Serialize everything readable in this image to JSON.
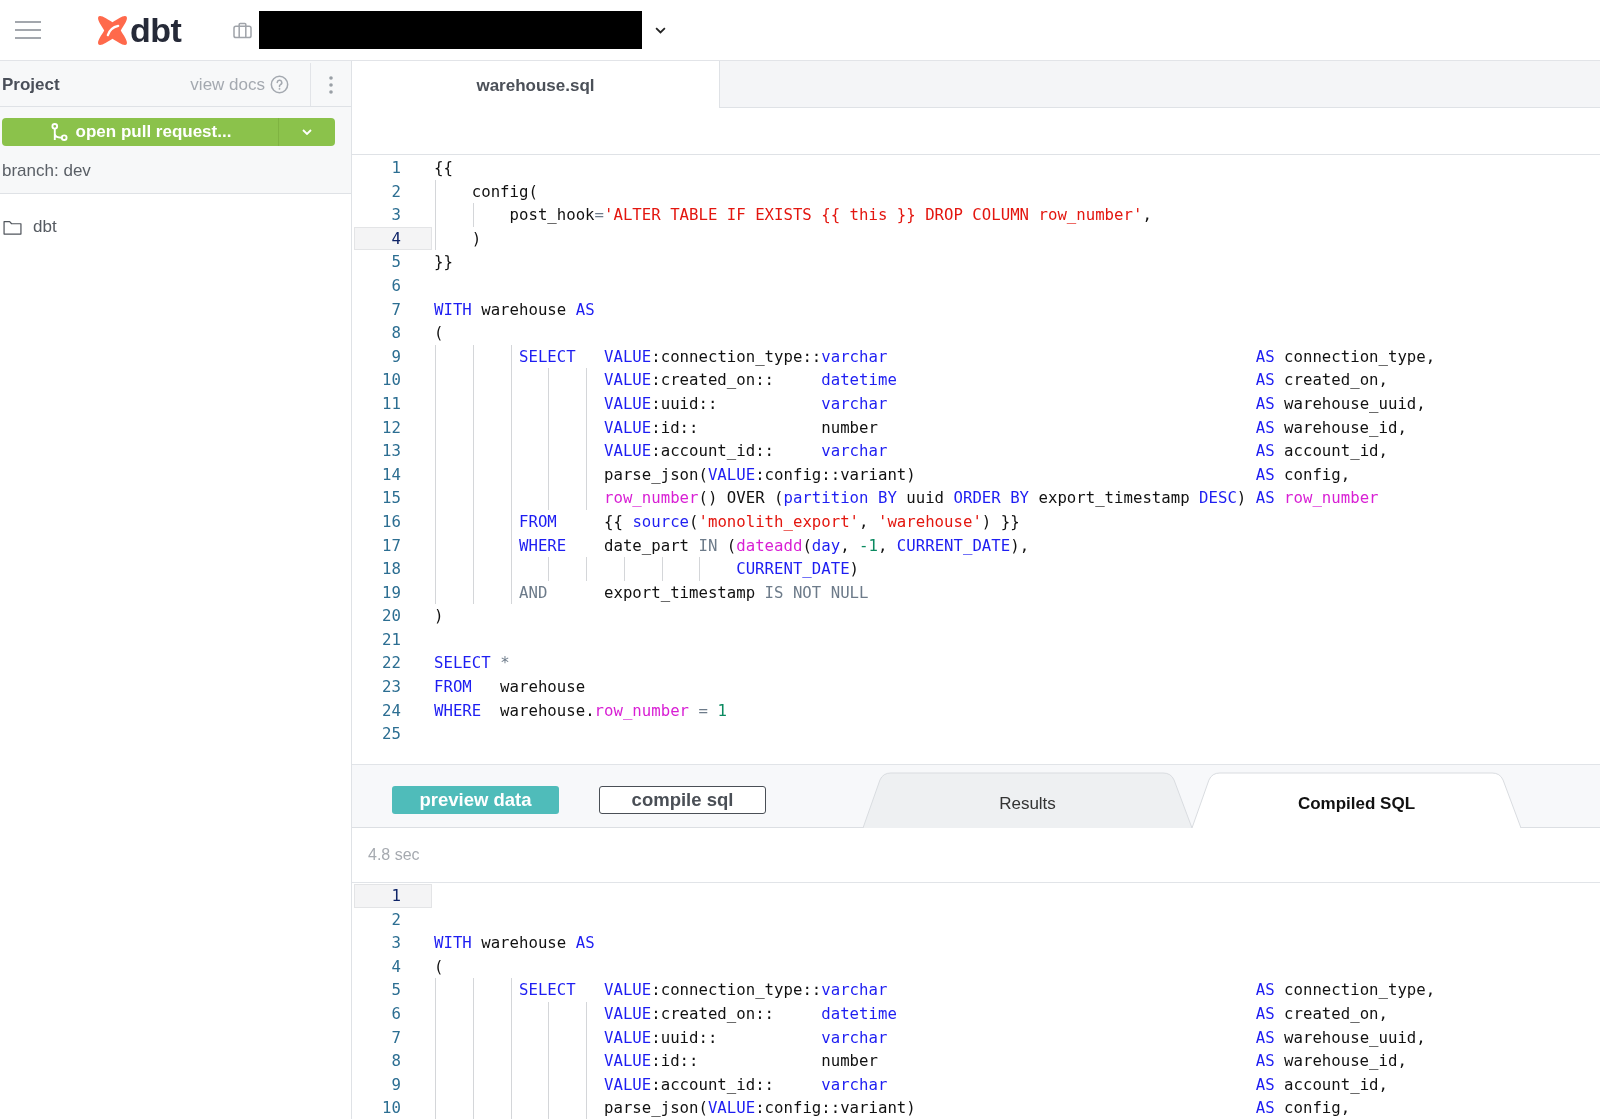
{
  "top_bar": {
    "logo": "dbt"
  },
  "sidebar": {
    "title": "Project",
    "docs_link": "view docs",
    "pull_request_button": "open pull request...",
    "branch": "branch: dev",
    "files": [
      {
        "name": "dbt",
        "kind": "folder"
      }
    ]
  },
  "file_tabs": [
    {
      "label": "warehouse.sql",
      "selected": true
    }
  ],
  "editor": {
    "lines": [
      {
        "number": "1",
        "active": false,
        "tokens": [
          {
            "kind": "plain",
            "text": "{{"
          }
        ]
      },
      {
        "number": "2",
        "active": false,
        "tokens": [
          {
            "kind": "plain",
            "text": "    config("
          }
        ]
      },
      {
        "number": "3",
        "active": false,
        "tokens": [
          {
            "kind": "plain",
            "text": "        post_hook"
          },
          {
            "kind": "operator",
            "text": "="
          },
          {
            "kind": "string",
            "text": "'ALTER TABLE IF EXISTS {{ this }} DROP COLUMN row_number'"
          },
          {
            "kind": "plain",
            "text": ","
          }
        ]
      },
      {
        "number": "4",
        "active": true,
        "tokens": [
          {
            "kind": "plain",
            "text": "    )"
          }
        ]
      },
      {
        "number": "5",
        "active": false,
        "tokens": [
          {
            "kind": "plain",
            "text": "}}"
          }
        ]
      },
      {
        "number": "6",
        "active": false
      },
      {
        "number": "7",
        "active": false,
        "tokens": [
          {
            "kind": "keyword",
            "text": "WITH"
          },
          {
            "kind": "plain",
            "text": " warehouse "
          },
          {
            "kind": "keyword",
            "text": "AS"
          }
        ]
      },
      {
        "number": "8",
        "active": false,
        "tokens": [
          {
            "kind": "plain",
            "text": "("
          }
        ]
      },
      {
        "number": "9",
        "active": false,
        "tokens": [
          {
            "kind": "keyword",
            "text": "         SELECT   "
          },
          {
            "kind": "keyword",
            "text": "VALUE"
          },
          {
            "kind": "plain",
            "text": ":connection_type::"
          },
          {
            "kind": "keyword",
            "text": "varchar                                       "
          },
          {
            "kind": "keyword",
            "text": "AS"
          },
          {
            "kind": "plain",
            "text": " connection_type,"
          }
        ]
      },
      {
        "number": "10",
        "active": false,
        "tokens": [
          {
            "kind": "keyword",
            "text": "                  VALUE"
          },
          {
            "kind": "plain",
            "text": ":created_on::     "
          },
          {
            "kind": "keyword",
            "text": "datetime                                      "
          },
          {
            "kind": "keyword",
            "text": "AS"
          },
          {
            "kind": "plain",
            "text": " created_on,"
          }
        ]
      },
      {
        "number": "11",
        "active": false,
        "tokens": [
          {
            "kind": "keyword",
            "text": "                  VALUE"
          },
          {
            "kind": "plain",
            "text": ":uuid::           "
          },
          {
            "kind": "keyword",
            "text": "varchar                                       "
          },
          {
            "kind": "keyword",
            "text": "AS"
          },
          {
            "kind": "plain",
            "text": " warehouse_uuid,"
          }
        ]
      },
      {
        "number": "12",
        "active": false,
        "tokens": [
          {
            "kind": "keyword",
            "text": "                  VALUE"
          },
          {
            "kind": "plain",
            "text": ":id::             number                                        "
          },
          {
            "kind": "keyword",
            "text": "AS"
          },
          {
            "kind": "plain",
            "text": " warehouse_id,"
          }
        ]
      },
      {
        "number": "13",
        "active": false,
        "tokens": [
          {
            "kind": "keyword",
            "text": "                  VALUE"
          },
          {
            "kind": "plain",
            "text": ":account_id::     "
          },
          {
            "kind": "keyword",
            "text": "varchar                                       "
          },
          {
            "kind": "keyword",
            "text": "AS"
          },
          {
            "kind": "plain",
            "text": " account_id,"
          }
        ]
      },
      {
        "number": "14",
        "active": false,
        "tokens": [
          {
            "kind": "plain",
            "text": "                  parse_json("
          },
          {
            "kind": "keyword",
            "text": "VALUE"
          },
          {
            "kind": "plain",
            "text": ":config::variant)                                    "
          },
          {
            "kind": "keyword",
            "text": "AS"
          },
          {
            "kind": "plain",
            "text": " config,"
          }
        ]
      },
      {
        "number": "15",
        "active": false,
        "tokens": [
          {
            "kind": "function",
            "text": "                  row_number"
          },
          {
            "kind": "plain",
            "text": "() OVER ("
          },
          {
            "kind": "keyword",
            "text": "partition BY"
          },
          {
            "kind": "plain",
            "text": " uuid "
          },
          {
            "kind": "keyword",
            "text": "ORDER BY"
          },
          {
            "kind": "plain",
            "text": " export_timestamp "
          },
          {
            "kind": "keyword",
            "text": "DESC"
          },
          {
            "kind": "plain",
            "text": ") "
          },
          {
            "kind": "keyword",
            "text": "AS "
          },
          {
            "kind": "function",
            "text": "row_number"
          }
        ]
      },
      {
        "number": "16",
        "active": false,
        "tokens": [
          {
            "kind": "keyword",
            "text": "         FROM     "
          },
          {
            "kind": "plain",
            "text": "{{ "
          },
          {
            "kind": "keyword",
            "text": "source"
          },
          {
            "kind": "plain",
            "text": "("
          },
          {
            "kind": "string",
            "text": "'monolith_export'"
          },
          {
            "kind": "plain",
            "text": ", "
          },
          {
            "kind": "string",
            "text": "'warehouse'"
          },
          {
            "kind": "plain",
            "text": ") }}"
          }
        ]
      },
      {
        "number": "17",
        "active": false,
        "tokens": [
          {
            "kind": "keyword",
            "text": "         WHERE    "
          },
          {
            "kind": "plain",
            "text": "date_part "
          },
          {
            "kind": "operator",
            "text": "IN"
          },
          {
            "kind": "plain",
            "text": " ("
          },
          {
            "kind": "function",
            "text": "dateadd"
          },
          {
            "kind": "plain",
            "text": "("
          },
          {
            "kind": "keyword",
            "text": "day"
          },
          {
            "kind": "plain",
            "text": ", "
          },
          {
            "kind": "number",
            "text": "-1"
          },
          {
            "kind": "plain",
            "text": ", "
          },
          {
            "kind": "keyword",
            "text": "CURRENT_DATE"
          },
          {
            "kind": "plain",
            "text": "),"
          }
        ]
      },
      {
        "number": "18",
        "active": false,
        "tokens": [
          {
            "kind": "keyword",
            "text": "                                CURRENT_DATE"
          },
          {
            "kind": "plain",
            "text": ")"
          }
        ]
      },
      {
        "number": "19",
        "active": false,
        "tokens": [
          {
            "kind": "operator",
            "text": "         AND      "
          },
          {
            "kind": "plain",
            "text": "export_timestamp "
          },
          {
            "kind": "operator",
            "text": "IS NOT NULL"
          }
        ]
      },
      {
        "number": "20",
        "active": false,
        "tokens": [
          {
            "kind": "plain",
            "text": ")"
          }
        ]
      },
      {
        "number": "21",
        "active": false
      },
      {
        "number": "22",
        "active": false,
        "tokens": [
          {
            "kind": "keyword",
            "text": "SELECT "
          },
          {
            "kind": "operator",
            "text": "*"
          }
        ]
      },
      {
        "number": "23",
        "active": false,
        "tokens": [
          {
            "kind": "keyword",
            "text": "FROM"
          },
          {
            "kind": "plain",
            "text": "   warehouse"
          }
        ]
      },
      {
        "number": "24",
        "active": false,
        "tokens": [
          {
            "kind": "keyword",
            "text": "WHERE"
          },
          {
            "kind": "plain",
            "text": "  warehouse."
          },
          {
            "kind": "function",
            "text": "row_number"
          },
          {
            "kind": "operator",
            "text": " = "
          },
          {
            "kind": "number",
            "text": "1"
          }
        ]
      },
      {
        "number": "25",
        "active": false
      }
    ]
  },
  "toolbar": {
    "buttons": [
      {
        "label": "preview data",
        "kind": "primary"
      },
      {
        "label": "compile sql",
        "kind": "outline"
      }
    ],
    "tabs": [
      {
        "label": "Results",
        "selected": false
      },
      {
        "label": "Compiled SQL",
        "selected": true
      }
    ]
  },
  "run_status": "4.8 sec",
  "compiled_sql": {
    "lines": [
      {
        "number": "1",
        "active": true
      },
      {
        "number": "2",
        "active": false
      },
      {
        "number": "3",
        "active": false,
        "tokens": [
          {
            "kind": "keyword",
            "text": "WITH"
          },
          {
            "kind": "plain",
            "text": " warehouse "
          },
          {
            "kind": "keyword",
            "text": "AS"
          }
        ]
      },
      {
        "number": "4",
        "active": false,
        "tokens": [
          {
            "kind": "plain",
            "text": "("
          }
        ]
      },
      {
        "number": "5",
        "active": false,
        "tokens": [
          {
            "kind": "keyword",
            "text": "         SELECT   "
          },
          {
            "kind": "keyword",
            "text": "VALUE"
          },
          {
            "kind": "plain",
            "text": ":connection_type::"
          },
          {
            "kind": "keyword",
            "text": "varchar                                       "
          },
          {
            "kind": "keyword",
            "text": "AS"
          },
          {
            "kind": "plain",
            "text": " connection_type,"
          }
        ]
      },
      {
        "number": "6",
        "active": false,
        "tokens": [
          {
            "kind": "keyword",
            "text": "                  VALUE"
          },
          {
            "kind": "plain",
            "text": ":created_on::     "
          },
          {
            "kind": "keyword",
            "text": "datetime                                      "
          },
          {
            "kind": "keyword",
            "text": "AS"
          },
          {
            "kind": "plain",
            "text": " created_on,"
          }
        ]
      },
      {
        "number": "7",
        "active": false,
        "tokens": [
          {
            "kind": "keyword",
            "text": "                  VALUE"
          },
          {
            "kind": "plain",
            "text": ":uuid::           "
          },
          {
            "kind": "keyword",
            "text": "varchar                                       "
          },
          {
            "kind": "keyword",
            "text": "AS"
          },
          {
            "kind": "plain",
            "text": " warehouse_uuid,"
          }
        ]
      },
      {
        "number": "8",
        "active": false,
        "tokens": [
          {
            "kind": "keyword",
            "text": "                  VALUE"
          },
          {
            "kind": "plain",
            "text": ":id::             number                                        "
          },
          {
            "kind": "keyword",
            "text": "AS"
          },
          {
            "kind": "plain",
            "text": " warehouse_id,"
          }
        ]
      },
      {
        "number": "9",
        "active": false,
        "tokens": [
          {
            "kind": "keyword",
            "text": "                  VALUE"
          },
          {
            "kind": "plain",
            "text": ":account_id::     "
          },
          {
            "kind": "keyword",
            "text": "varchar                                       "
          },
          {
            "kind": "keyword",
            "text": "AS"
          },
          {
            "kind": "plain",
            "text": " account_id,"
          }
        ]
      },
      {
        "number": "10",
        "active": false,
        "tokens": [
          {
            "kind": "plain",
            "text": "                  parse_json("
          },
          {
            "kind": "keyword",
            "text": "VALUE"
          },
          {
            "kind": "plain",
            "text": ":config::variant)                                    "
          },
          {
            "kind": "keyword",
            "text": "AS"
          },
          {
            "kind": "plain",
            "text": " config,"
          }
        ]
      }
    ]
  }
}
